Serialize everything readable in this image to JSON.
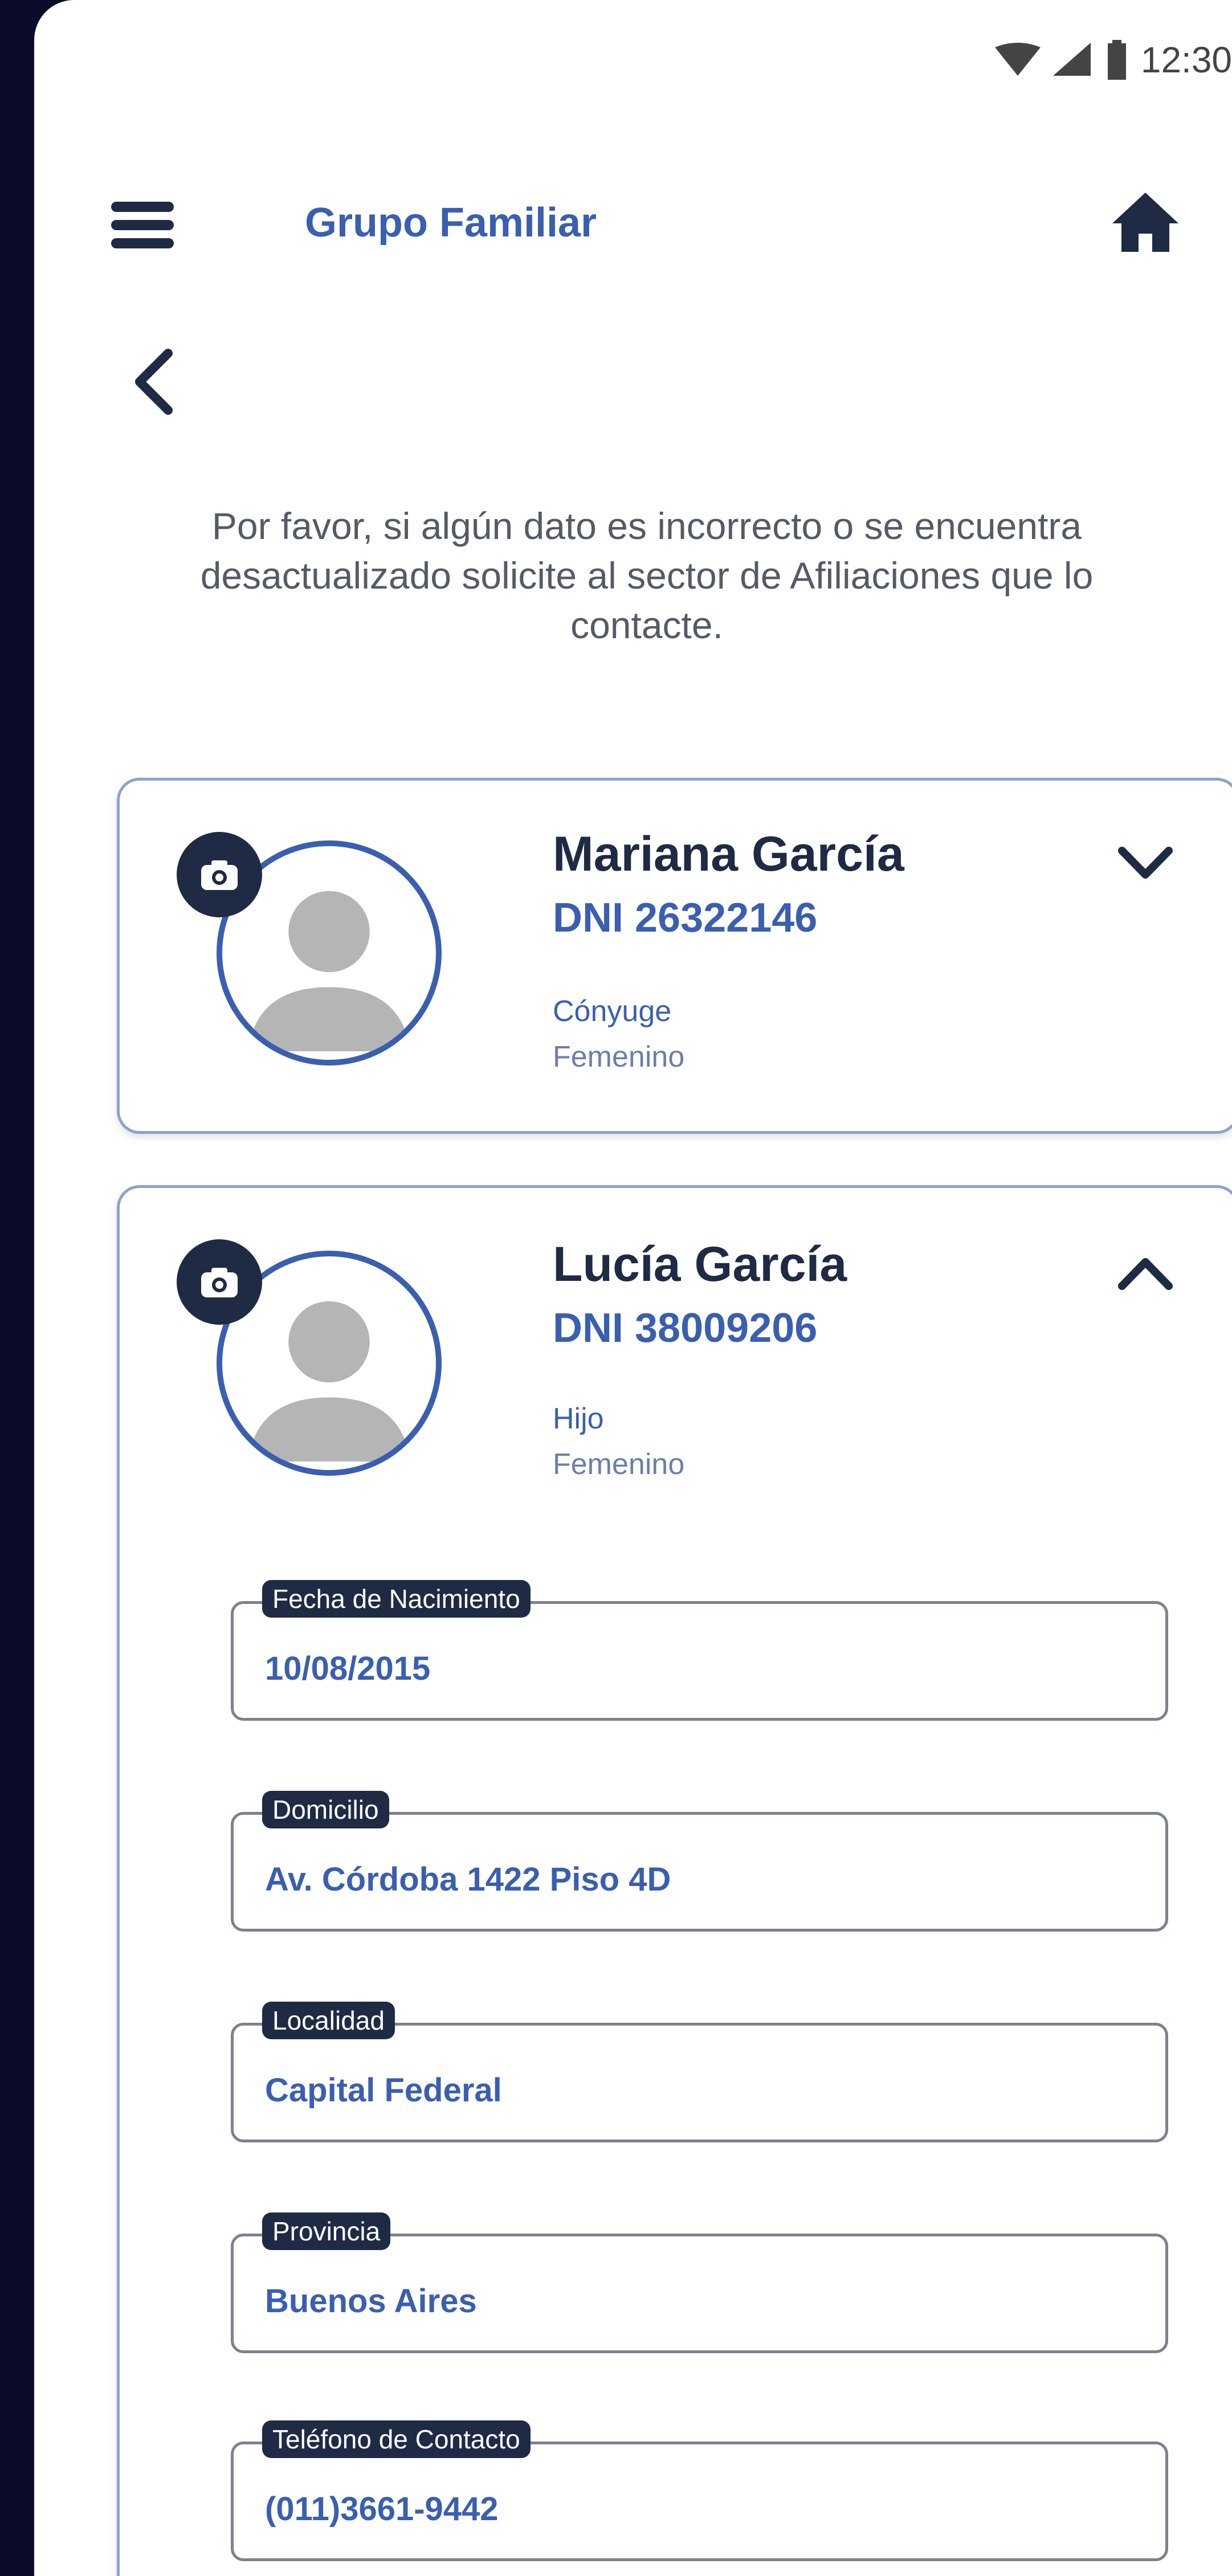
{
  "status_bar": {
    "time": "12:30"
  },
  "header": {
    "title": "Grupo Familiar"
  },
  "notice": "Por favor, si algún dato es incorrecto o se encuentra desactualizado solicite al sector de Afiliaciones que lo contacte.",
  "members": [
    {
      "name": "Mariana García",
      "dni": "DNI 26322146",
      "relationship": "Cónyuge",
      "gender": "Femenino",
      "expanded": false
    },
    {
      "name": "Lucía García",
      "dni": "DNI 38009206",
      "relationship": "Hijo",
      "gender": "Femenino",
      "expanded": true,
      "fields": [
        {
          "label": "Fecha de Nacimiento",
          "value": "10/08/2015"
        },
        {
          "label": "Domicilio",
          "value": "Av. Córdoba 1422 Piso 4D"
        },
        {
          "label": "Localidad",
          "value": "Capital Federal"
        },
        {
          "label": "Provincia",
          "value": "Buenos Aires"
        },
        {
          "label": "Teléfono de Contacto",
          "value": "(011)3661-9442"
        }
      ]
    }
  ],
  "colors": {
    "accent": "#3a5fb0",
    "dark": "#1f2a44",
    "frame": "#0b0b2a"
  }
}
